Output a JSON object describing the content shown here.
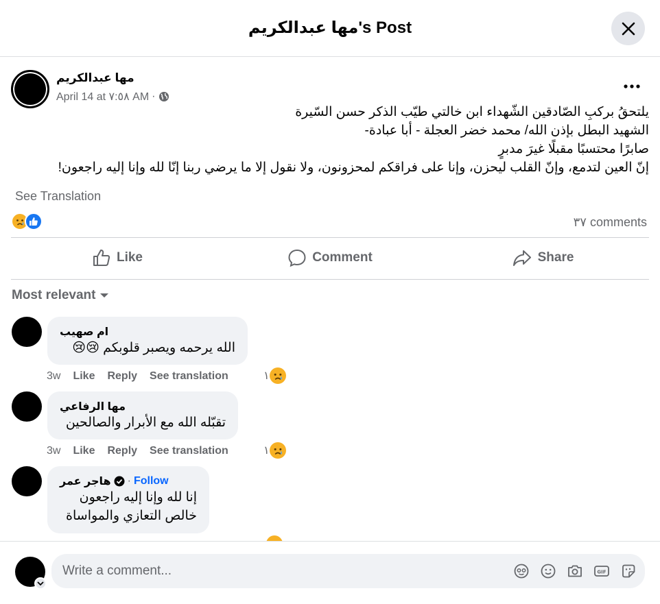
{
  "header": {
    "title": "مها عبدالكريم's Post"
  },
  "post": {
    "author": "مها عبدالكريم",
    "date": "April 14 at ٧:٥٨ AM",
    "separator": "·",
    "lines": [
      "يلتحقُ بركبِ الصّادقين الشّهداء ابن خالتي طيّب الذكر حسن السّيرة",
      "الشهيد البطل بإذن الله/ محمد خضر العجلة - أبا عبادة-",
      "صابرًا محتسبًا مقبلًا غيرَ مدبرٍ",
      "إنّ العين لتدمع، وإنّ القلب ليحزن، وإنا على فراقكم لمحزونون، ولا نقول إلا ما يرضي ربنا إنّا لله وإنا إليه راجعون!"
    ],
    "see_translation": "See Translation",
    "comments_count": "٣٧ comments"
  },
  "actions": {
    "like": "Like",
    "comment": "Comment",
    "share": "Share"
  },
  "sort": {
    "label": "Most relevant"
  },
  "comments": [
    {
      "name": "ام صهيب",
      "text": "الله يرحمه ويصبر قلوبكم 😢😢",
      "time": "3w",
      "like": "Like",
      "reply": "Reply",
      "see_translation": "See translation",
      "reaction_count": "١"
    },
    {
      "name": "مها الرفاعي",
      "text": "تقبّله الله مع الأبرار والصالحين",
      "time": "3w",
      "like": "Like",
      "reply": "Reply",
      "see_translation": "See translation",
      "reaction_count": "١"
    },
    {
      "name": "هاجر عمر",
      "follow": "Follow",
      "dot": "·",
      "lines": [
        "إنا لله وإنا إليه راجعون",
        "خالص التعازي والمواساة"
      ]
    }
  ],
  "composer": {
    "placeholder": "Write a comment..."
  },
  "colors": {
    "sad": "#f7b125",
    "like": "#1877f2",
    "follow": "#0866ff",
    "secondary_text": "#65676b"
  }
}
